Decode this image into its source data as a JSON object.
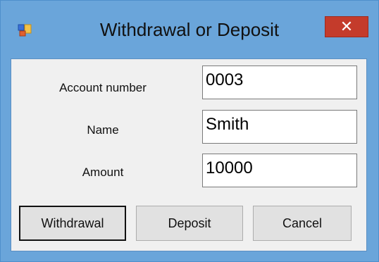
{
  "window": {
    "title": "Withdrawal or Deposit",
    "close_glyph": "✕"
  },
  "form": {
    "account_number_label": "Account number",
    "account_number_value": "0003",
    "name_label": "Name",
    "name_value": "Smith",
    "amount_label": "Amount",
    "amount_value": "10000"
  },
  "buttons": {
    "withdrawal_label": "Withdrawal",
    "deposit_label": "Deposit",
    "cancel_label": "Cancel"
  },
  "icons": {
    "app": "form-window-icon",
    "close": "close-icon"
  },
  "colors": {
    "frame": "#6aa5da",
    "close_button": "#c43b2b",
    "client_background": "#f0f0f0"
  }
}
